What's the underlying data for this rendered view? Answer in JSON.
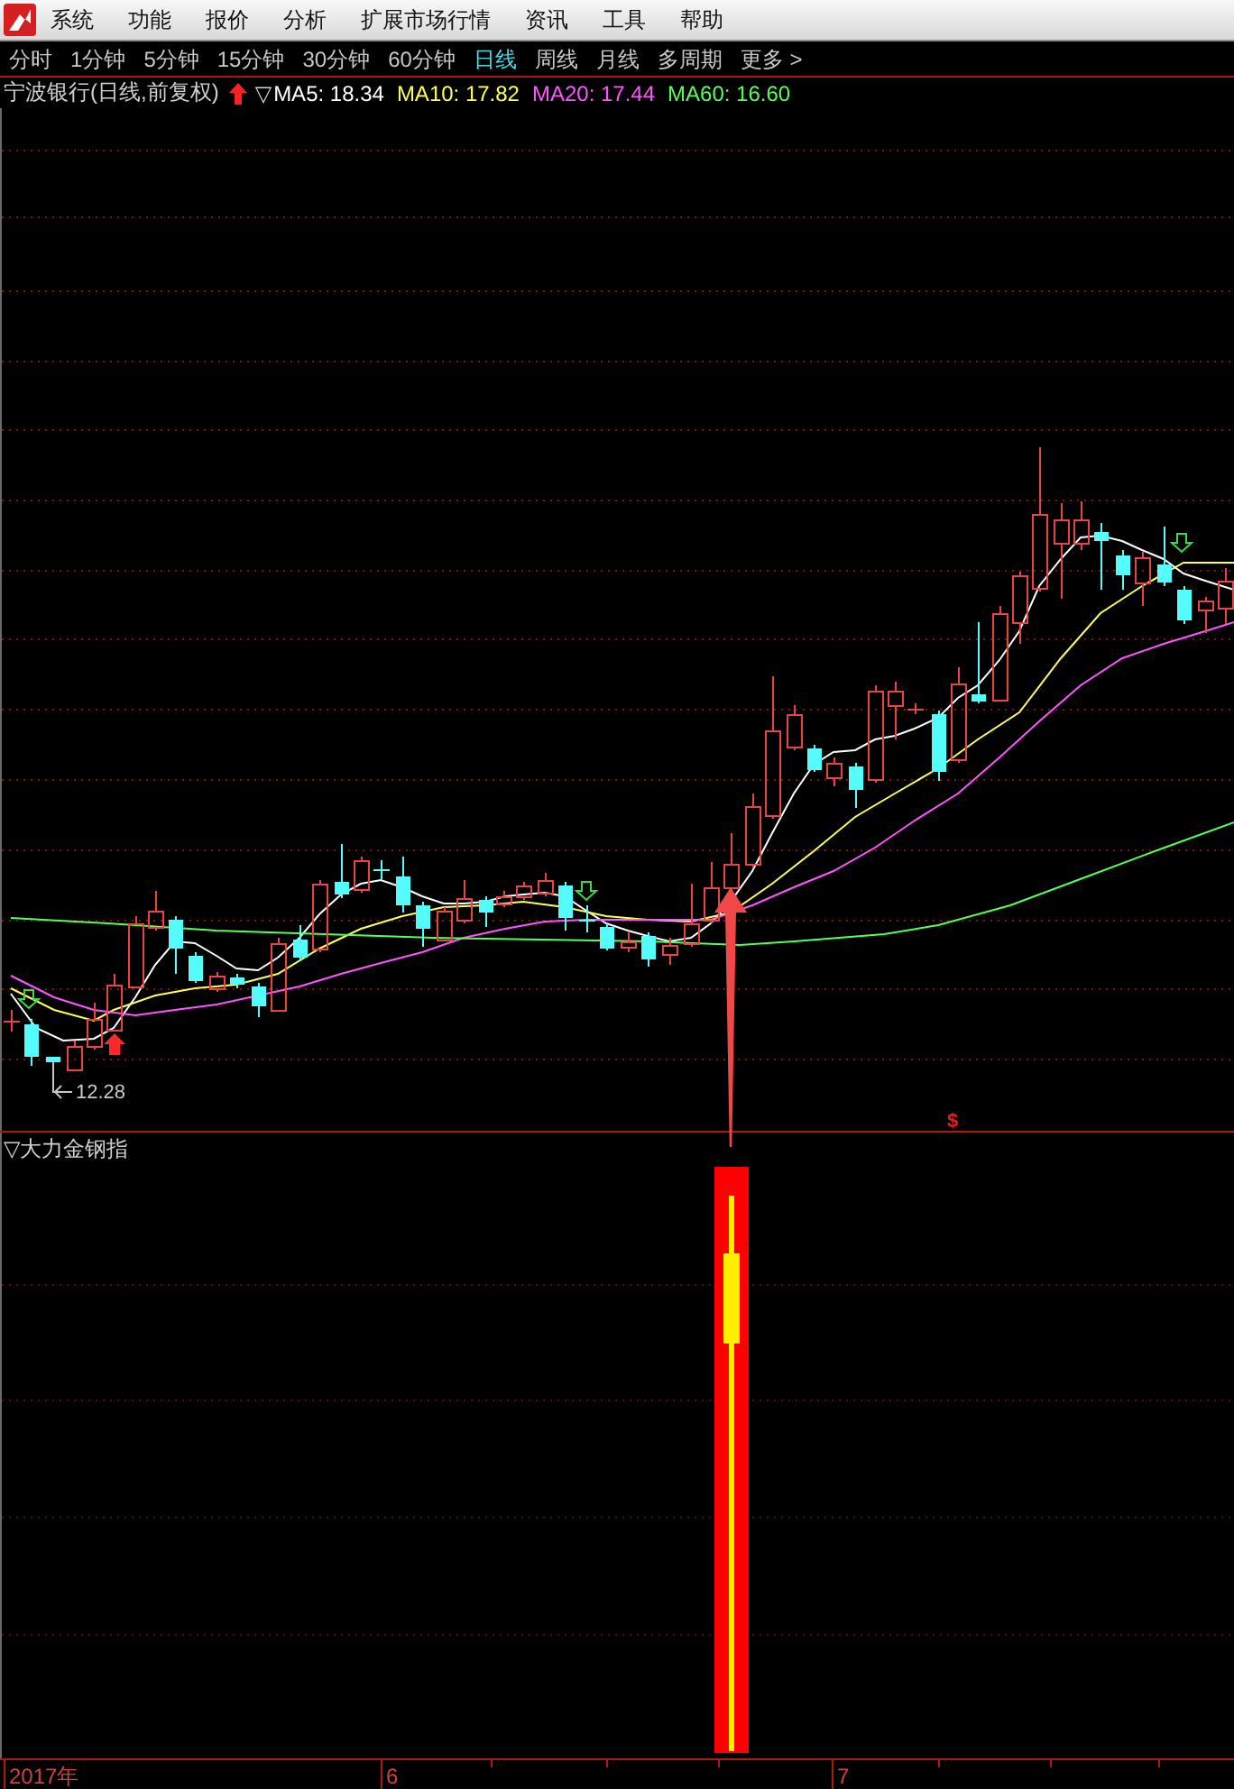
{
  "menu_bar": {
    "items": [
      "系统",
      "功能",
      "报价",
      "分析",
      "扩展市场行情",
      "资讯",
      "工具",
      "帮助"
    ]
  },
  "period_tabs": [
    {
      "label": "分时",
      "selected": false
    },
    {
      "label": "1分钟",
      "selected": false
    },
    {
      "label": "5分钟",
      "selected": false
    },
    {
      "label": "15分钟",
      "selected": false
    },
    {
      "label": "30分钟",
      "selected": false
    },
    {
      "label": "60分钟",
      "selected": false
    },
    {
      "label": "日线",
      "selected": true
    },
    {
      "label": "周线",
      "selected": false
    },
    {
      "label": "月线",
      "selected": false
    },
    {
      "label": "多周期",
      "selected": false
    },
    {
      "label": "更多 >",
      "selected": false
    }
  ],
  "chart_header": {
    "title": "宁波银行(日线,前复权)",
    "toggle": "▽",
    "ma_readings": [
      {
        "label": "MA5: 18.34",
        "color": "#ffffff"
      },
      {
        "label": "MA10: 17.82",
        "color": "#ffff55"
      },
      {
        "label": "MA20: 17.44",
        "color": "#ff55ff"
      },
      {
        "label": "MA60: 16.60",
        "color": "#55ff55"
      }
    ]
  },
  "main_chart": {
    "low_price_label": "12.28",
    "marker": "$"
  },
  "indicator_panel": {
    "title": "▽大力金钢指"
  },
  "time_axis": {
    "labels": [
      "2017年",
      "6",
      "7"
    ]
  }
}
